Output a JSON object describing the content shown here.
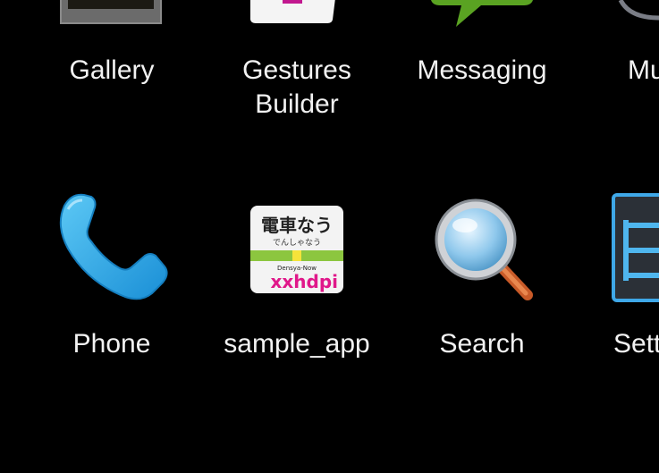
{
  "apps_row1": [
    {
      "label": "Gallery",
      "icon": "gallery-icon"
    },
    {
      "label": "Gestures\nBuilder",
      "icon": "gestures-builder-icon"
    },
    {
      "label": "Messaging",
      "icon": "messaging-icon"
    },
    {
      "label": "Mu",
      "icon": "music-icon"
    }
  ],
  "apps_row2": [
    {
      "label": "Phone",
      "icon": "phone-icon"
    },
    {
      "label": "sample_app",
      "icon": "sample-app-icon",
      "icon_text": {
        "title": "電車なう",
        "subtitle": "でんしゃなう",
        "brand": "Densya-Now",
        "badge": "xxhdpi"
      }
    },
    {
      "label": "Search",
      "icon": "search-icon"
    },
    {
      "label": "Sett",
      "icon": "settings-icon"
    }
  ],
  "colors": {
    "background": "#000000",
    "phone_blue": "#29a8e8",
    "message_green": "#5aa322",
    "badge_magenta": "#e0188a",
    "station_green": "#8cc63f"
  }
}
